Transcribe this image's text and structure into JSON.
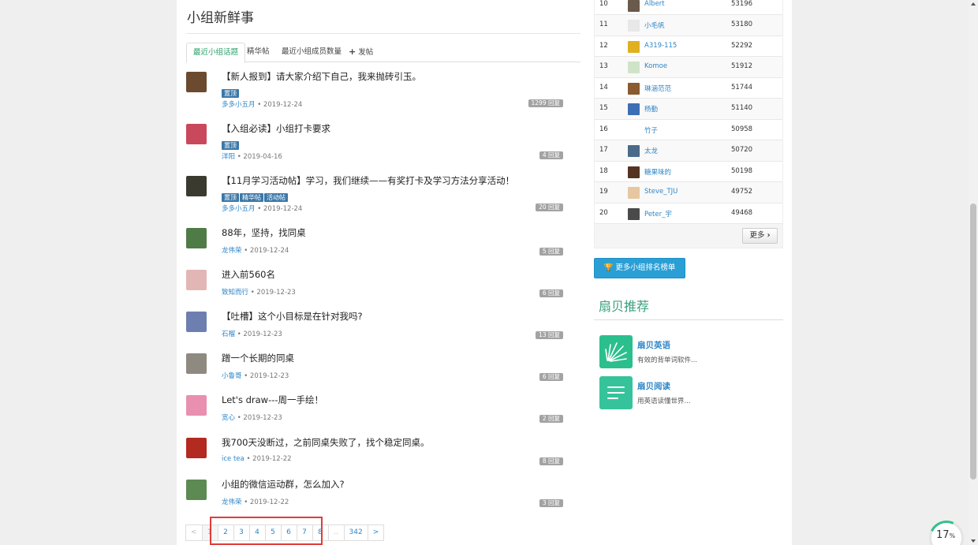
{
  "section_title": "小组新鲜事",
  "tabs": [
    {
      "label": "最近小组话题",
      "active": true
    },
    {
      "label": "精华帖"
    },
    {
      "label": "最近小组成员数量"
    },
    {
      "label": "发帖"
    }
  ],
  "topics": [
    {
      "title": "【新人报到】请大家介绍下自己，我来抛砖引玉。",
      "badges": [
        "置顶"
      ],
      "author": "多多小五月",
      "date": "• 2019-12-24",
      "replies": "1299 回复"
    },
    {
      "title": "【入组必读】小组打卡要求",
      "badges": [
        "置顶"
      ],
      "author": "洋阳",
      "date": "• 2019-04-16",
      "replies": "4 回复"
    },
    {
      "title": "【11月学习活动帖】学习，我们继续——有奖打卡及学习方法分享活动！",
      "badges": [
        "置顶",
        "精华帖",
        "活动帖"
      ],
      "author": "多多小五月",
      "date": "• 2019-12-24",
      "replies": "20 回复"
    },
    {
      "title": "88年，坚持，找同桌",
      "badges": [],
      "author": "龙伟荣",
      "date": "• 2019-12-24",
      "replies": "5 回复"
    },
    {
      "title": "进入前560名",
      "badges": [],
      "author": "致知而行",
      "date": "• 2019-12-23",
      "replies": "6 回复"
    },
    {
      "title": "【吐槽】这个小目标是在针对我吗?",
      "badges": [],
      "author": "石榴",
      "date": "• 2019-12-23",
      "replies": "13 回复"
    },
    {
      "title": "蹭一个长期的同桌",
      "badges": [],
      "author": "小鲁哥",
      "date": "• 2019-12-23",
      "replies": "6 回复"
    },
    {
      "title": "Let's draw---周一手绘！",
      "badges": [],
      "author": "宽心",
      "date": "• 2019-12-23",
      "replies": "2 回复"
    },
    {
      "title": "我700天没断过，之前同桌失败了，找个稳定同桌。",
      "badges": [],
      "author": "ice tea",
      "date": "• 2019-12-22",
      "replies": "8 回复"
    },
    {
      "title": "小组的微信运动群，怎么加入?",
      "badges": [],
      "author": "龙伟荣",
      "date": "• 2019-12-22",
      "replies": "3 回复"
    }
  ],
  "pagination": [
    "<",
    "1",
    "2",
    "3",
    "4",
    "5",
    "6",
    "7",
    "8",
    "..",
    "342",
    ">"
  ],
  "ranking": [
    {
      "rank": "10",
      "name": "Albert",
      "score": "53196"
    },
    {
      "rank": "11",
      "name": "小毛帆",
      "score": "53180"
    },
    {
      "rank": "12",
      "name": "A319-115",
      "score": "52292"
    },
    {
      "rank": "13",
      "name": "Komoe",
      "score": "51912"
    },
    {
      "rank": "14",
      "name": "琳涵范范",
      "score": "51744"
    },
    {
      "rank": "15",
      "name": "杨勤",
      "score": "51140"
    },
    {
      "rank": "16",
      "name": "竹子",
      "score": "50958"
    },
    {
      "rank": "17",
      "name": "太龙",
      "score": "50720"
    },
    {
      "rank": "18",
      "name": "糖果味的",
      "score": "50198"
    },
    {
      "rank": "19",
      "name": "Steve_TJU",
      "score": "49752"
    },
    {
      "rank": "20",
      "name": "Peter_宇",
      "score": "49468"
    }
  ],
  "more_label": "更多",
  "rank_button": "更多小组排名榜单",
  "recommend_title": "扇贝推荐",
  "apps": [
    {
      "name": "扇贝英语",
      "desc": "有效的背单词软件..."
    },
    {
      "name": "扇贝阅读",
      "desc": "用英语读懂世界..."
    }
  ],
  "progress": {
    "value": "17",
    "unit": "%"
  },
  "colors": {
    "accent_green": "#29a06a",
    "link_blue": "#2e86c8",
    "badge_blue": "#3b78a8",
    "rank_button": "#2a9fd6",
    "highlight_red": "#e23b3b"
  }
}
